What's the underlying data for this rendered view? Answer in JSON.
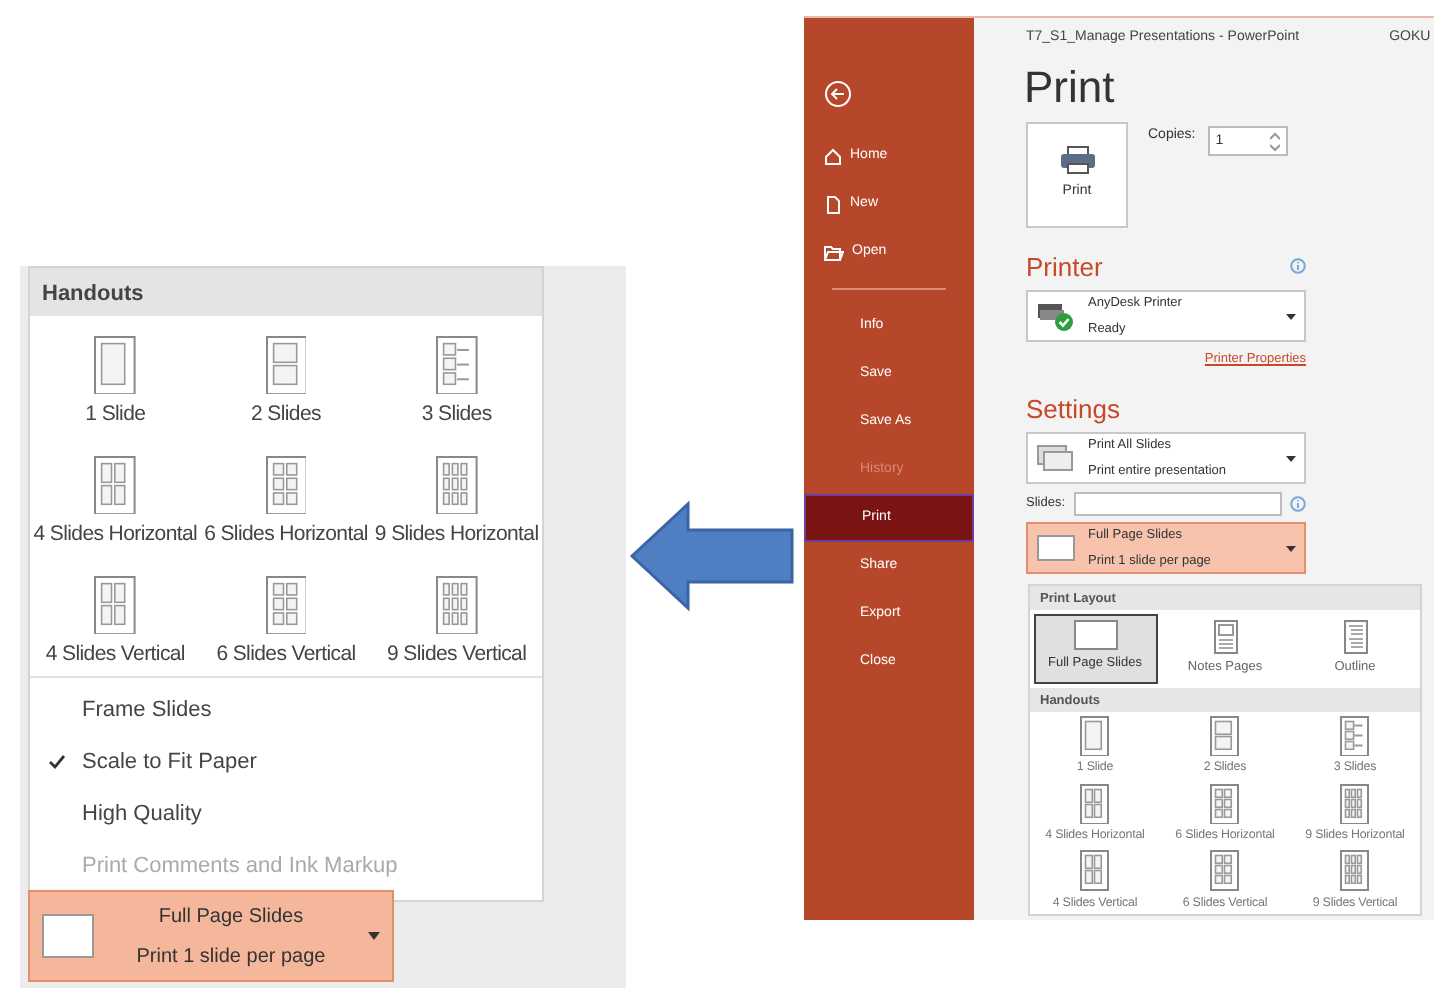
{
  "zoomed_panel": {
    "section_title": "Handouts",
    "handouts": [
      {
        "label": "1 Slide"
      },
      {
        "label": "2 Slides"
      },
      {
        "label": "3 Slides"
      },
      {
        "label": "4 Slides Horizontal"
      },
      {
        "label": "6 Slides Horizontal"
      },
      {
        "label": "9 Slides Horizontal"
      },
      {
        "label": "4 Slides Vertical"
      },
      {
        "label": "6 Slides Vertical"
      },
      {
        "label": "9 Slides Vertical"
      }
    ],
    "options": [
      {
        "label": "Frame Slides",
        "checked": false,
        "disabled": false
      },
      {
        "label": "Scale to Fit Paper",
        "checked": true,
        "disabled": false
      },
      {
        "label": "High Quality",
        "checked": false,
        "disabled": false
      },
      {
        "label": "Print Comments and Ink Markup",
        "checked": false,
        "disabled": true
      }
    ],
    "layout_button": {
      "title": "Full Page Slides",
      "subtitle": "Print 1 slide per page"
    }
  },
  "window": {
    "title": "T7_S1_Manage Presentations  -  PowerPoint",
    "user": "GOKU",
    "nav": [
      {
        "label": "Home",
        "kind": "home",
        "selected": false,
        "disabled": false
      },
      {
        "label": "New",
        "kind": "new",
        "selected": false,
        "disabled": false
      },
      {
        "label": "Open",
        "kind": "open",
        "selected": false,
        "disabled": false
      },
      {
        "label": "Info",
        "kind": "text",
        "selected": false,
        "disabled": false
      },
      {
        "label": "Save",
        "kind": "text",
        "selected": false,
        "disabled": false
      },
      {
        "label": "Save As",
        "kind": "text",
        "selected": false,
        "disabled": false
      },
      {
        "label": "History",
        "kind": "text",
        "selected": false,
        "disabled": true
      },
      {
        "label": "Print",
        "kind": "text",
        "selected": true,
        "disabled": false
      },
      {
        "label": "Share",
        "kind": "text",
        "selected": false,
        "disabled": false
      },
      {
        "label": "Export",
        "kind": "text",
        "selected": false,
        "disabled": false
      },
      {
        "label": "Close",
        "kind": "text",
        "selected": false,
        "disabled": false
      }
    ],
    "page_title": "Print",
    "print_button": "Print",
    "copies_label": "Copies:",
    "copies_value": "1",
    "printer_heading": "Printer",
    "printer": {
      "title": "AnyDesk Printer",
      "subtitle": "Ready"
    },
    "printer_properties": "Printer Properties",
    "settings_heading": "Settings",
    "slides_setting": {
      "title": "Print All Slides",
      "subtitle": "Print entire presentation"
    },
    "slides_label": "Slides:",
    "layout_setting": {
      "title": "Full Page Slides",
      "subtitle": "Print 1 slide per page"
    },
    "layout_menu": {
      "print_layout_title": "Print Layout",
      "layouts": [
        {
          "label": "Full Page Slides",
          "selected": true
        },
        {
          "label": "Notes Pages",
          "selected": false
        },
        {
          "label": "Outline",
          "selected": false
        }
      ],
      "handouts_title": "Handouts",
      "handouts": [
        {
          "label": "1 Slide"
        },
        {
          "label": "2 Slides"
        },
        {
          "label": "3 Slides"
        },
        {
          "label": "4 Slides Horizontal"
        },
        {
          "label": "6 Slides Horizontal"
        },
        {
          "label": "9 Slides Horizontal"
        },
        {
          "label": "4 Slides Vertical"
        },
        {
          "label": "6 Slides Vertical"
        },
        {
          "label": "9 Slides Vertical"
        }
      ]
    }
  }
}
